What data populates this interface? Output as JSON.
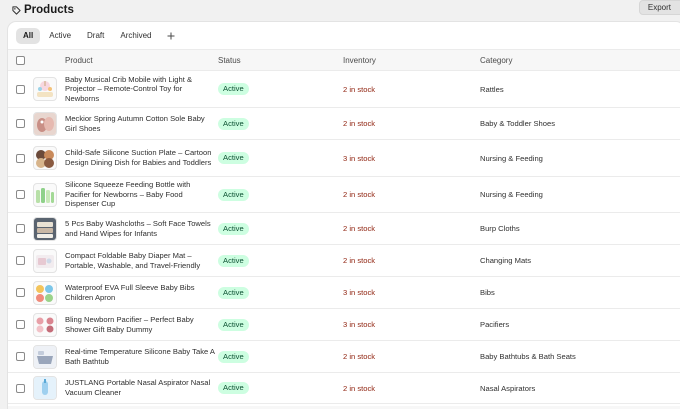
{
  "page": {
    "title": "Products",
    "export_label": "Export"
  },
  "tabs": [
    "All",
    "Active",
    "Draft",
    "Archived"
  ],
  "table": {
    "headers": {
      "product": "Product",
      "status": "Status",
      "inventory": "Inventory",
      "category": "Category"
    },
    "rows": [
      {
        "name": "Baby Musical Crib Mobile with Light & Projector – Remote-Control Toy for Newborns",
        "status": "Active",
        "inventory": "2 in stock",
        "category": "Rattles",
        "thumb": "crib-mobile"
      },
      {
        "name": "Meckior Spring Autumn Cotton Sole Baby Girl Shoes",
        "status": "Active",
        "inventory": "2 in stock",
        "category": "Baby & Toddler Shoes",
        "thumb": "shoes"
      },
      {
        "name": "Child-Safe Silicone Suction Plate – Cartoon Design Dining Dish for Babies and Toddlers",
        "status": "Active",
        "inventory": "3 in stock",
        "category": "Nursing & Feeding",
        "thumb": "plates"
      },
      {
        "name": "Silicone Squeeze Feeding Bottle with Pacifier for Newborns – Baby Food Dispenser Cup",
        "status": "Active",
        "inventory": "2 in stock",
        "category": "Nursing & Feeding",
        "thumb": "bottles"
      },
      {
        "name": "5 Pcs Baby Washcloths – Soft Face Towels and Hand Wipes for Infants",
        "status": "Active",
        "inventory": "2 in stock",
        "category": "Burp Cloths",
        "thumb": "washcloths"
      },
      {
        "name": "Compact Foldable Baby Diaper Mat – Portable, Washable, and Travel-Friendly",
        "status": "Active",
        "inventory": "2 in stock",
        "category": "Changing Mats",
        "thumb": "diaper-mat"
      },
      {
        "name": "Waterproof EVA Full Sleeve Baby Bibs Children Apron",
        "status": "Active",
        "inventory": "3 in stock",
        "category": "Bibs",
        "thumb": "bibs"
      },
      {
        "name": "Bling Newborn Pacifier – Perfect Baby Shower Gift Baby Dummy",
        "status": "Active",
        "inventory": "3 in stock",
        "category": "Pacifiers",
        "thumb": "pacifiers"
      },
      {
        "name": "Real-time Temperature Silicone Baby Take A Bath Bathtub",
        "status": "Active",
        "inventory": "2 in stock",
        "category": "Baby Bathtubs & Bath Seats",
        "thumb": "bathtub"
      },
      {
        "name": "JUSTLANG Portable Nasal Aspirator Nasal Vacuum Cleaner",
        "status": "Active",
        "inventory": "2 in stock",
        "category": "Nasal Aspirators",
        "thumb": "aspirator"
      }
    ]
  },
  "colors": {
    "active_badge_bg": "#cdfee1",
    "active_badge_text": "#0c5132",
    "inventory_text": "#8e1f0b"
  }
}
